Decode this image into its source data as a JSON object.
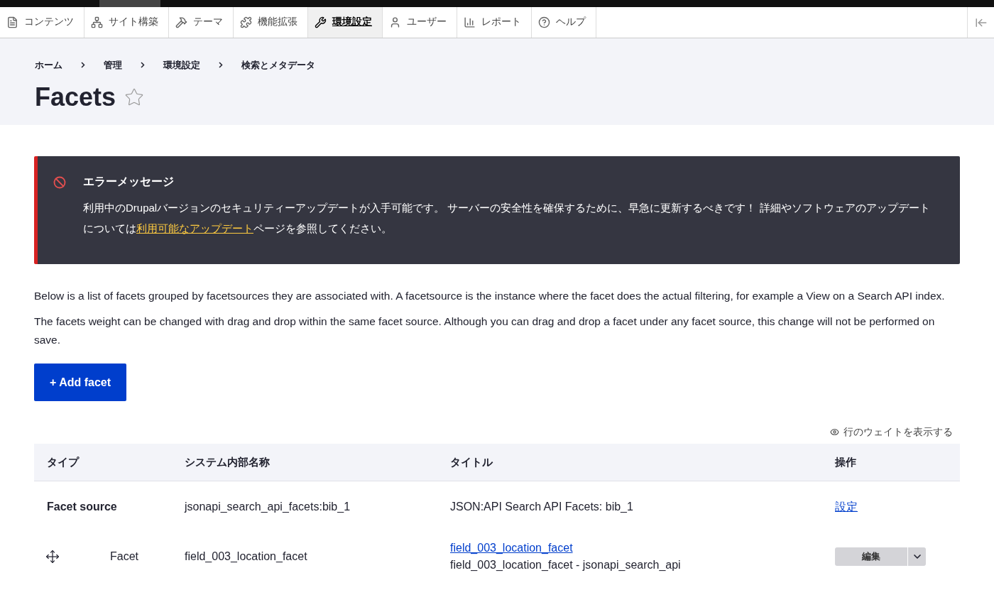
{
  "toolbar": {
    "items": [
      {
        "label": "コンテンツ",
        "selected": false
      },
      {
        "label": "サイト構築",
        "selected": false
      },
      {
        "label": "テーマ",
        "selected": false
      },
      {
        "label": "機能拡張",
        "selected": false
      },
      {
        "label": "環境設定",
        "selected": true
      },
      {
        "label": "ユーザー",
        "selected": false
      },
      {
        "label": "レポート",
        "selected": false
      },
      {
        "label": "ヘルプ",
        "selected": false
      }
    ]
  },
  "breadcrumb": [
    "ホーム",
    "管理",
    "環境設定",
    "検索とメタデータ"
  ],
  "page_title": "Facets",
  "message": {
    "title": "エラーメッセージ",
    "text_before": "利用中のDrupalバージョンのセキュリティーアップデートが入手可能です。 サーバーの安全性を確保するために、早急に更新するべきです！ 詳細やソフトウェアのアップデートについては",
    "link": "利用可能なアップデート",
    "text_after": "ページを参照してください。"
  },
  "description": [
    "Below is a list of facets grouped by facetsources they are associated with. A facetsource is the instance where the facet does the actual filtering, for example a View on a Search API index.",
    "The facets weight can be changed with drag and drop within the same facet source. Although you can drag and drop a facet under any facet source, this change will not be performed on save."
  ],
  "add_button": "+ Add facet",
  "weights_toggle": "行のウェイトを表示する",
  "table": {
    "columns": [
      "タイプ",
      "システム内部名称",
      "タイトル",
      "操作"
    ],
    "rows": [
      {
        "kind": "source",
        "type": "Facet source",
        "machine_name": "jsonapi_search_api_facets:bib_1",
        "title": "JSON:API Search API Facets: bib_1",
        "operation": "設定"
      },
      {
        "kind": "facet",
        "type": "Facet",
        "machine_name": "field_003_location_facet",
        "title": "field_003_location_facet",
        "subtitle": "field_003_location_facet - jsonapi_search_api",
        "operation": "編集"
      }
    ]
  }
}
